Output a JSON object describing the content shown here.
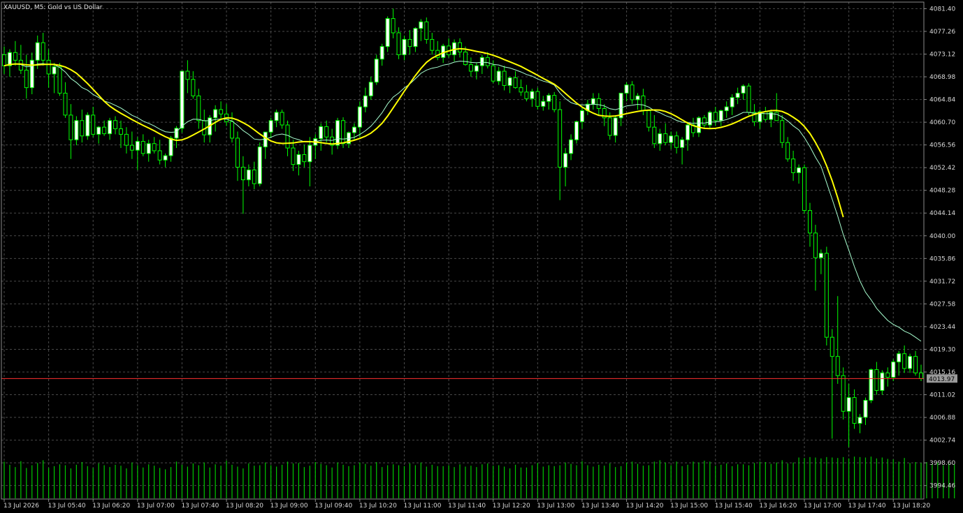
{
  "chart_title": "XAUUSD, M5:  Gold vs US Dollar",
  "current_price_label": "4013.97",
  "colors": {
    "background": "#000000",
    "grid": "#4a4a4a",
    "bull_candle": "#00ff00",
    "bear_candle_wick": "#00ff00",
    "bull_body_fill": "#ffffff",
    "bear_body_fill": "#000000",
    "ma_slow": "#ffff00",
    "ma_fast": "#a8ffd0",
    "volume": "#00c800",
    "price_line": "#ff3030",
    "price_tag": "#9a9a9a"
  },
  "chart_data": {
    "type": "candlestick",
    "symbol": "XAUUSD",
    "timeframe": "M5",
    "ylim": [
      3992.0,
      4082.6
    ],
    "y_ticks": [
      "4081.40",
      "4077.26",
      "4073.12",
      "4068.98",
      "4064.84",
      "4060.70",
      "4056.56",
      "4052.42",
      "4048.28",
      "4044.14",
      "4040.00",
      "4035.86",
      "4031.72",
      "4027.58",
      "4023.44",
      "4019.30",
      "4015.16",
      "4011.02",
      "4006.88",
      "4002.74",
      "3998.60",
      "3994.46"
    ],
    "x_ticks": [
      "13 Jul 2026",
      "13 Jul 05:40",
      "13 Jul 06:20",
      "13 Jul 07:00",
      "13 Jul 07:40",
      "13 Jul 08:20",
      "13 Jul 09:00",
      "13 Jul 09:40",
      "13 Jul 10:20",
      "13 Jul 11:00",
      "13 Jul 11:40",
      "13 Jul 12:20",
      "13 Jul 13:00",
      "13 Jul 13:40",
      "13 Jul 14:20",
      "13 Jul 15:00",
      "13 Jul 15:40",
      "13 Jul 16:20",
      "13 Jul 17:00",
      "13 Jul 17:40",
      "13 Jul 18:20"
    ],
    "current_price": 4013.97,
    "candles": [
      [
        4073.0,
        4074.5,
        4069.5,
        4071.0
      ],
      [
        4071.0,
        4074.0,
        4069.0,
        4073.4
      ],
      [
        4073.4,
        4075.5,
        4071.0,
        4072.0
      ],
      [
        4072.0,
        4074.8,
        4069.5,
        4070.2
      ],
      [
        4070.2,
        4073.0,
        4065.0,
        4067.0
      ],
      [
        4067.0,
        4073.4,
        4065.8,
        4072.0
      ],
      [
        4072.0,
        4076.5,
        4070.4,
        4075.2
      ],
      [
        4075.2,
        4077.0,
        4071.0,
        4072.0
      ],
      [
        4072.0,
        4074.0,
        4067.0,
        4069.5
      ],
      [
        4069.5,
        4071.5,
        4066.0,
        4070.8
      ],
      [
        4070.8,
        4071.5,
        4065.5,
        4066.0
      ],
      [
        4066.0,
        4068.0,
        4061.5,
        4062.0
      ],
      [
        4062.0,
        4064.0,
        4054.0,
        4057.5
      ],
      [
        4057.5,
        4061.8,
        4056.5,
        4061.0
      ],
      [
        4061.0,
        4063.0,
        4057.0,
        4058.2
      ],
      [
        4058.2,
        4062.5,
        4057.5,
        4062.0
      ],
      [
        4062.0,
        4063.5,
        4058.0,
        4058.5
      ],
      [
        4058.5,
        4060.0,
        4056.8,
        4059.8
      ],
      [
        4059.8,
        4061.0,
        4058.2,
        4058.6
      ],
      [
        4058.6,
        4061.5,
        4057.5,
        4061.0
      ],
      [
        4061.0,
        4061.8,
        4058.5,
        4059.5
      ],
      [
        4059.5,
        4061.0,
        4056.0,
        4058.5
      ],
      [
        4058.5,
        4059.8,
        4055.0,
        4056.5
      ],
      [
        4056.5,
        4059.0,
        4054.0,
        4055.6
      ],
      [
        4055.6,
        4058.0,
        4052.0,
        4057.2
      ],
      [
        4057.2,
        4058.5,
        4054.5,
        4055.0
      ],
      [
        4055.0,
        4057.5,
        4053.5,
        4056.8
      ],
      [
        4056.8,
        4058.0,
        4055.0,
        4055.5
      ],
      [
        4055.5,
        4057.5,
        4053.0,
        4053.8
      ],
      [
        4053.8,
        4055.0,
        4052.5,
        4054.6
      ],
      [
        4054.6,
        4058.2,
        4053.5,
        4057.8
      ],
      [
        4057.8,
        4060.0,
        4056.0,
        4059.6
      ],
      [
        4059.6,
        4063.0,
        4058.8,
        4070.0
      ],
      [
        4070.0,
        4072.0,
        4066.0,
        4068.5
      ],
      [
        4068.5,
        4070.0,
        4065.0,
        4065.5
      ],
      [
        4065.5,
        4066.8,
        4059.5,
        4061.0
      ],
      [
        4061.0,
        4063.0,
        4057.0,
        4058.4
      ],
      [
        4058.4,
        4062.0,
        4057.0,
        4061.5
      ],
      [
        4061.5,
        4063.8,
        4059.0,
        4063.0
      ],
      [
        4063.0,
        4064.5,
        4061.0,
        4062.2
      ],
      [
        4062.2,
        4064.0,
        4060.0,
        4060.8
      ],
      [
        4060.8,
        4062.5,
        4057.0,
        4057.8
      ],
      [
        4057.8,
        4059.0,
        4050.0,
        4052.5
      ],
      [
        4052.5,
        4054.5,
        4044.0,
        4050.2
      ],
      [
        4050.2,
        4053.0,
        4049.0,
        4052.0
      ],
      [
        4052.0,
        4053.5,
        4048.5,
        4049.5
      ],
      [
        4049.5,
        4057.0,
        4049.0,
        4056.2
      ],
      [
        4056.2,
        4058.0,
        4054.0,
        4058.9
      ],
      [
        4058.9,
        4061.5,
        4057.8,
        4061.0
      ],
      [
        4061.0,
        4063.0,
        4059.8,
        4062.5
      ],
      [
        4062.5,
        4063.0,
        4059.5,
        4060.2
      ],
      [
        4060.2,
        4061.0,
        4054.5,
        4056.0
      ],
      [
        4056.0,
        4057.5,
        4051.8,
        4053.0
      ],
      [
        4053.0,
        4055.5,
        4051.0,
        4054.8
      ],
      [
        4054.8,
        4056.6,
        4052.5,
        4053.5
      ],
      [
        4053.5,
        4058.0,
        4049.0,
        4056.5
      ],
      [
        4056.5,
        4058.5,
        4054.0,
        4057.7
      ],
      [
        4057.7,
        4060.5,
        4055.5,
        4059.9
      ],
      [
        4059.9,
        4061.0,
        4057.0,
        4058.0
      ],
      [
        4058.0,
        4059.5,
        4054.8,
        4056.5
      ],
      [
        4056.5,
        4061.5,
        4055.8,
        4061.0
      ],
      [
        4061.0,
        4061.6,
        4056.0,
        4056.8
      ],
      [
        4056.8,
        4059.0,
        4056.0,
        4058.8
      ],
      [
        4058.8,
        4060.5,
        4057.5,
        4059.8
      ],
      [
        4059.8,
        4064.5,
        4058.0,
        4063.5
      ],
      [
        4063.5,
        4067.0,
        4062.5,
        4065.5
      ],
      [
        4065.5,
        4069.0,
        4064.8,
        4068.0
      ],
      [
        4068.0,
        4073.0,
        4067.5,
        4072.2
      ],
      [
        4072.2,
        4075.0,
        4071.0,
        4074.5
      ],
      [
        4074.5,
        4080.0,
        4073.5,
        4079.6
      ],
      [
        4079.6,
        4081.4,
        4076.0,
        4077.0
      ],
      [
        4077.0,
        4078.0,
        4072.2,
        4073.0
      ],
      [
        4073.0,
        4076.5,
        4072.0,
        4075.8
      ],
      [
        4075.8,
        4077.5,
        4073.0,
        4074.5
      ],
      [
        4074.5,
        4078.0,
        4073.5,
        4077.8
      ],
      [
        4077.8,
        4079.5,
        4075.5,
        4079.0
      ],
      [
        4079.0,
        4079.8,
        4075.0,
        4075.8
      ],
      [
        4075.8,
        4077.0,
        4073.0,
        4073.8
      ],
      [
        4073.8,
        4075.5,
        4072.0,
        4072.5
      ],
      [
        4072.5,
        4075.0,
        4071.5,
        4074.6
      ],
      [
        4074.6,
        4076.0,
        4072.5,
        4073.0
      ],
      [
        4073.0,
        4075.8,
        4071.8,
        4075.2
      ],
      [
        4075.2,
        4076.0,
        4072.5,
        4073.5
      ],
      [
        4073.5,
        4074.5,
        4071.0,
        4071.2
      ],
      [
        4071.2,
        4072.5,
        4069.0,
        4070.0
      ],
      [
        4070.0,
        4071.6,
        4068.5,
        4071.0
      ],
      [
        4071.0,
        4073.0,
        4069.5,
        4072.5
      ],
      [
        4072.5,
        4073.5,
        4070.5,
        4071.0
      ],
      [
        4071.0,
        4072.0,
        4067.8,
        4068.2
      ],
      [
        4068.2,
        4070.8,
        4067.5,
        4070.0
      ],
      [
        4070.0,
        4071.0,
        4066.5,
        4067.4
      ],
      [
        4067.4,
        4069.0,
        4066.0,
        4068.8
      ],
      [
        4068.8,
        4070.0,
        4066.8,
        4067.0
      ],
      [
        4067.0,
        4068.5,
        4065.5,
        4066.2
      ],
      [
        4066.2,
        4067.5,
        4064.5,
        4065.0
      ],
      [
        4065.0,
        4066.8,
        4063.5,
        4066.3
      ],
      [
        4066.3,
        4067.0,
        4063.0,
        4063.6
      ],
      [
        4063.6,
        4065.5,
        4062.8,
        4064.5
      ],
      [
        4064.5,
        4066.0,
        4063.0,
        4065.6
      ],
      [
        4065.6,
        4066.2,
        4062.5,
        4063.0
      ],
      [
        4063.0,
        4064.5,
        4046.5,
        4052.5
      ],
      [
        4052.5,
        4056.0,
        4049.0,
        4055.0
      ],
      [
        4055.0,
        4058.5,
        4053.8,
        4057.5
      ],
      [
        4057.5,
        4061.0,
        4056.8,
        4060.8
      ],
      [
        4060.8,
        4063.5,
        4059.5,
        4062.8
      ],
      [
        4062.8,
        4064.8,
        4062.0,
        4064.0
      ],
      [
        4064.0,
        4066.0,
        4063.0,
        4065.0
      ],
      [
        4065.0,
        4066.0,
        4062.0,
        4063.2
      ],
      [
        4063.2,
        4064.0,
        4060.0,
        4061.5
      ],
      [
        4061.5,
        4062.5,
        4057.5,
        4058.3
      ],
      [
        4058.3,
        4062.0,
        4057.0,
        4061.5
      ],
      [
        4061.5,
        4066.0,
        4060.0,
        4066.0
      ],
      [
        4066.0,
        4068.0,
        4064.5,
        4067.5
      ],
      [
        4067.5,
        4068.2,
        4064.0,
        4064.8
      ],
      [
        4064.8,
        4066.0,
        4063.0,
        4065.5
      ],
      [
        4065.5,
        4066.8,
        4062.0,
        4062.8
      ],
      [
        4062.8,
        4063.0,
        4059.0,
        4059.8
      ],
      [
        4059.8,
        4062.0,
        4056.0,
        4056.8
      ],
      [
        4056.8,
        4059.5,
        4055.5,
        4058.6
      ],
      [
        4058.6,
        4060.5,
        4056.5,
        4057.0
      ],
      [
        4057.0,
        4059.0,
        4055.8,
        4058.2
      ],
      [
        4058.2,
        4059.0,
        4055.0,
        4056.1
      ],
      [
        4056.1,
        4058.0,
        4053.0,
        4057.5
      ],
      [
        4057.5,
        4060.8,
        4055.5,
        4060.2
      ],
      [
        4060.2,
        4061.5,
        4058.0,
        4058.8
      ],
      [
        4058.8,
        4061.8,
        4058.0,
        4061.5
      ],
      [
        4061.5,
        4062.0,
        4059.5,
        4060.2
      ],
      [
        4060.2,
        4062.8,
        4059.5,
        4062.5
      ],
      [
        4062.5,
        4063.5,
        4060.0,
        4061.0
      ],
      [
        4061.0,
        4063.0,
        4060.0,
        4062.8
      ],
      [
        4062.8,
        4064.5,
        4061.5,
        4063.5
      ],
      [
        4063.5,
        4065.8,
        4062.0,
        4065.2
      ],
      [
        4065.2,
        4067.0,
        4064.0,
        4066.0
      ],
      [
        4066.0,
        4067.6,
        4064.8,
        4067.3
      ],
      [
        4067.3,
        4067.8,
        4062.0,
        4062.5
      ],
      [
        4062.5,
        4064.0,
        4060.0,
        4060.8
      ],
      [
        4060.8,
        4063.0,
        4059.5,
        4062.6
      ],
      [
        4062.6,
        4063.5,
        4060.8,
        4061.2
      ],
      [
        4061.2,
        4063.0,
        4059.8,
        4062.5
      ],
      [
        4062.5,
        4066.0,
        4061.5,
        4061.0
      ],
      [
        4061.0,
        4062.0,
        4056.0,
        4057.0
      ],
      [
        4057.0,
        4058.0,
        4053.5,
        4054.0
      ],
      [
        4054.0,
        4055.5,
        4050.0,
        4051.5
      ],
      [
        4051.5,
        4053.0,
        4049.5,
        4052.4
      ],
      [
        4052.4,
        4053.0,
        4044.0,
        4044.6
      ],
      [
        4044.6,
        4046.0,
        4038.0,
        4040.5
      ],
      [
        4040.5,
        4042.0,
        4030.0,
        4036.0
      ],
      [
        4036.0,
        4037.5,
        4033.0,
        4036.8
      ],
      [
        4036.8,
        4038.0,
        4020.0,
        4021.5
      ],
      [
        4021.5,
        4023.0,
        4003.0,
        4018.0
      ],
      [
        4018.0,
        4029.0,
        4013.0,
        4014.5
      ],
      [
        4014.5,
        4016.0,
        4006.5,
        4008.0
      ],
      [
        4008.0,
        4013.0,
        4001.5,
        4010.5
      ],
      [
        4010.5,
        4012.0,
        4004.8,
        4005.8
      ],
      [
        4005.8,
        4007.5,
        4004.0,
        4006.9
      ],
      [
        4006.9,
        4010.5,
        4005.5,
        4010.0
      ],
      [
        4010.0,
        4015.8,
        4009.5,
        4015.6
      ],
      [
        4015.6,
        4017.0,
        4011.0,
        4011.8
      ],
      [
        4011.8,
        4015.5,
        4011.0,
        4015.0
      ],
      [
        4015.0,
        4016.0,
        4012.5,
        4014.2
      ],
      [
        4014.2,
        4017.5,
        4013.5,
        4017.0
      ],
      [
        4017.0,
        4019.0,
        4014.5,
        4018.5
      ],
      [
        4018.5,
        4020.0,
        4015.0,
        4015.8
      ],
      [
        4015.8,
        4018.5,
        4015.0,
        4018.0
      ],
      [
        4018.0,
        4019.0,
        4014.5,
        4015.0
      ],
      [
        4015.0,
        4016.5,
        4013.5,
        4013.97
      ]
    ],
    "volume": [
      81,
      74,
      69,
      82,
      67,
      73,
      78,
      84,
      67,
      71,
      75,
      73,
      66,
      74,
      80,
      71,
      67,
      77,
      73,
      69,
      74,
      72,
      66,
      79,
      73,
      68,
      75,
      72,
      67,
      64,
      69,
      81,
      74,
      70,
      77,
      73,
      79,
      68,
      75,
      72,
      83,
      74,
      70,
      66,
      77,
      72,
      73,
      79,
      73,
      70,
      74,
      81,
      77,
      78,
      69,
      72,
      80,
      76,
      73,
      68,
      79,
      74,
      71,
      73,
      79,
      76,
      72,
      80,
      69,
      73,
      75,
      73,
      71,
      77,
      73,
      79,
      70,
      74,
      71,
      71,
      73,
      69,
      75,
      70,
      72,
      69,
      75,
      77,
      72,
      73,
      70,
      66,
      74,
      68,
      68,
      73,
      78,
      70,
      73,
      71,
      73,
      79,
      76,
      73,
      82,
      73,
      70,
      74,
      72,
      77,
      69,
      71,
      79,
      81,
      76,
      72,
      73,
      81,
      84,
      79,
      73,
      81,
      71,
      74,
      81,
      79,
      83,
      81,
      72,
      74,
      77,
      71,
      75,
      75,
      73,
      78,
      81,
      80,
      76,
      79,
      84,
      77,
      79,
      90,
      89,
      91,
      90,
      88,
      91,
      90,
      89,
      91,
      88,
      92,
      91,
      90,
      92,
      88,
      90,
      87,
      86,
      81,
      89,
      78,
      80,
      78,
      80,
      76,
      79,
      73,
      77,
      75
    ]
  }
}
